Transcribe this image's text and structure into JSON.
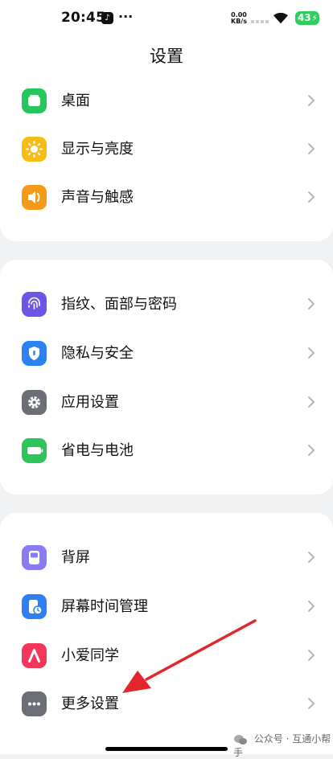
{
  "status_bar": {
    "time": "20:45",
    "tiktok_glyph": "♪",
    "more_dots": "···",
    "net_speed_value": "0.00",
    "net_speed_unit": "KB/s",
    "battery_level": "43"
  },
  "header": {
    "title": "设置"
  },
  "groups": [
    {
      "items": [
        {
          "label": "桌面",
          "icon": "desktop-icon",
          "color": "#25c65b"
        },
        {
          "label": "显示与亮度",
          "icon": "sun-icon",
          "color": "#f7bd15"
        },
        {
          "label": "声音与触感",
          "icon": "speaker-icon",
          "color": "#f59a18"
        }
      ]
    },
    {
      "items": [
        {
          "label": "指纹、面部与密码",
          "icon": "fingerprint-icon",
          "color": "#6c56e6"
        },
        {
          "label": "隐私与安全",
          "icon": "shield-icon",
          "color": "#2d82f3"
        },
        {
          "label": "应用设置",
          "icon": "gear-icon",
          "color": "#6b6e74"
        },
        {
          "label": "省电与电池",
          "icon": "battery-icon",
          "color": "#2dc45a"
        }
      ]
    },
    {
      "items": [
        {
          "label": "背屏",
          "icon": "rear-screen-icon",
          "color": "#8b7bf0"
        },
        {
          "label": "屏幕时间管理",
          "icon": "screen-time-icon",
          "color": "#2f7ff2"
        },
        {
          "label": "小爱同学",
          "icon": "xiaoai-icon",
          "color": "#f2385a"
        },
        {
          "label": "更多设置",
          "icon": "more-icon",
          "color": "#6b6e74"
        }
      ]
    }
  ],
  "watermark": {
    "text": "公众号 · 互通小帮手"
  },
  "annotation": {
    "arrow_color": "#e2262c"
  }
}
